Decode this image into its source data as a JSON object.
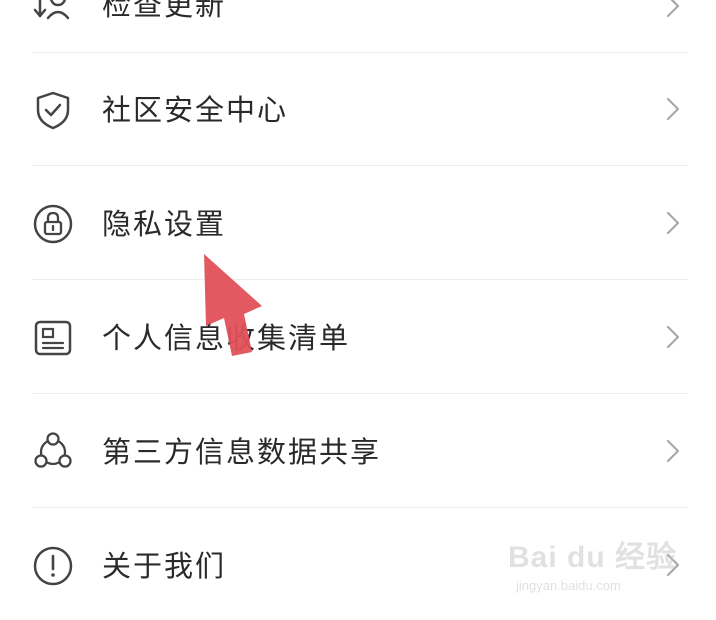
{
  "menu": {
    "items": [
      {
        "label": "检查更新",
        "icon": "download-update-icon"
      },
      {
        "label": "社区安全中心",
        "icon": "shield-check-icon"
      },
      {
        "label": "隐私设置",
        "icon": "lock-icon"
      },
      {
        "label": "个人信息收集清单",
        "icon": "id-card-icon"
      },
      {
        "label": "第三方信息数据共享",
        "icon": "share-nodes-icon"
      },
      {
        "label": "关于我们",
        "icon": "info-exclamation-icon"
      }
    ]
  },
  "watermark": {
    "logo": "Bai du 经验",
    "url": "jingyan.baidu.com"
  },
  "colors": {
    "text": "#2a2a2a",
    "icon": "#444444",
    "divider": "#ececec",
    "chevron": "#a8a8a8",
    "pointer_arrow": "#e0505a"
  }
}
